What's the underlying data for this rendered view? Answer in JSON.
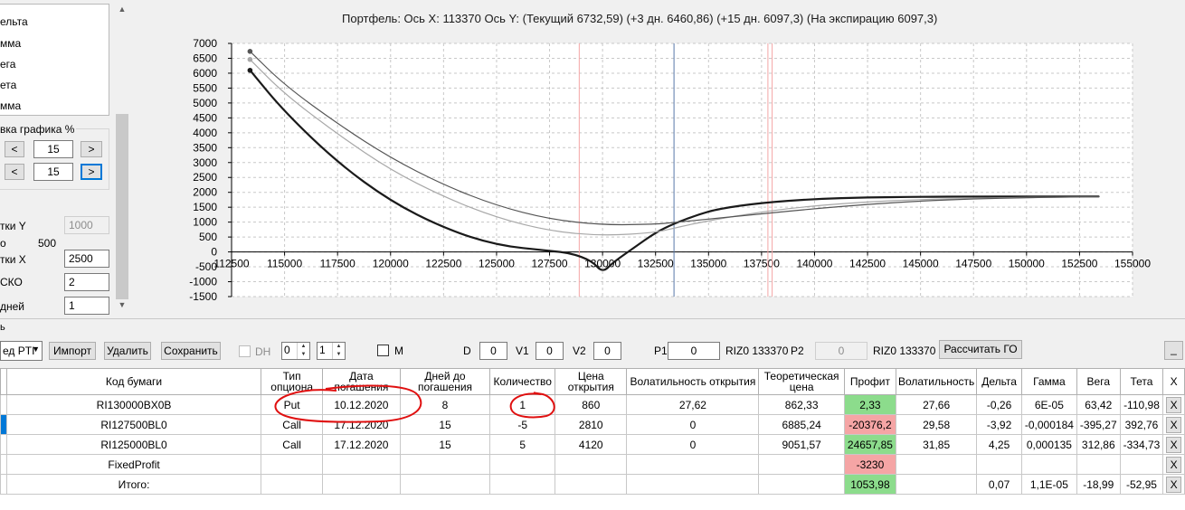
{
  "left_panel": {
    "list_items": [
      "ельта",
      "мма",
      "ега",
      "ета",
      "мма"
    ],
    "group_title": "вка графика %",
    "offset_rows": [
      {
        "prev": "<",
        "value": "15",
        "next": ">"
      },
      {
        "prev": "<",
        "value": "15",
        "next": ">"
      }
    ],
    "fields": [
      {
        "label": "тки Y",
        "value": "1000",
        "disabled": true
      },
      {
        "label": "о",
        "value_text": "500"
      },
      {
        "label": "тки X",
        "value": "2500"
      },
      {
        "label": "СКО",
        "value": "2"
      },
      {
        "label": "дней",
        "value": "1"
      }
    ]
  },
  "chart_title": "Портфель: Ось X: 113370 Ось Y:  (Текущий 6732,59)  (+3 дн. 6460,86)  (+15 дн. 6097,3)  (На экспирацию 6097,3)",
  "chart_data": {
    "type": "line",
    "xlim": [
      112500,
      155000
    ],
    "ylim": [
      -1500,
      7000
    ],
    "x_ticks": [
      "112500",
      "115000",
      "117500",
      "120000",
      "122500",
      "125000",
      "127500",
      "130000",
      "132500",
      "135000",
      "137500",
      "140000",
      "142500",
      "145000",
      "147500",
      "150000",
      "152500",
      "155000"
    ],
    "y_ticks": [
      "7000",
      "6500",
      "6000",
      "5500",
      "5000",
      "4500",
      "4000",
      "3500",
      "3000",
      "2500",
      "2000",
      "1500",
      "1000",
      "500",
      "0",
      "-500",
      "-1000",
      "-1500"
    ],
    "grid": true,
    "vlines": [
      {
        "x": 128900,
        "color": "#f4a6a6"
      },
      {
        "x": 133370,
        "color": "#5878a8"
      },
      {
        "x": 137800,
        "color": "#f4a6a6"
      },
      {
        "x": 138000,
        "color": "#f4a6a6"
      }
    ],
    "series": [
      {
        "color": "#1a1a1a",
        "width": 2.2,
        "x": [
          113370,
          115000,
          117500,
          120000,
          122500,
          125000,
          127500,
          128500,
          129500,
          130000,
          130500,
          131500,
          132500,
          133370,
          134500,
          135500,
          137500,
          140000,
          142500,
          145000,
          147500,
          150000,
          152500,
          153400
        ],
        "y": [
          6097,
          4700,
          3000,
          1700,
          800,
          220,
          40,
          -40,
          -300,
          -700,
          -350,
          150,
          650,
          950,
          1250,
          1450,
          1650,
          1780,
          1830,
          1850,
          1860,
          1860,
          1860,
          1860
        ]
      },
      {
        "color": "#a8a8a8",
        "width": 1.2,
        "x": [
          113370,
          115000,
          117500,
          120000,
          122500,
          125000,
          127500,
          130000,
          132500,
          133370,
          135000,
          137500,
          140000,
          142500,
          145000,
          147500,
          150000,
          152500,
          153400
        ],
        "y": [
          6461,
          5300,
          3950,
          2750,
          1850,
          1150,
          700,
          540,
          650,
          800,
          1050,
          1350,
          1550,
          1680,
          1760,
          1800,
          1830,
          1845,
          1850
        ]
      },
      {
        "color": "#555555",
        "width": 1.2,
        "x": [
          113370,
          115000,
          117500,
          120000,
          122500,
          125000,
          127500,
          130000,
          132500,
          133370,
          135000,
          137500,
          140000,
          142500,
          145000,
          147500,
          150000,
          152500,
          153400
        ],
        "y": [
          6733,
          5600,
          4300,
          3150,
          2250,
          1550,
          1100,
          900,
          930,
          990,
          1100,
          1280,
          1450,
          1600,
          1710,
          1780,
          1820,
          1845,
          1850
        ]
      }
    ]
  },
  "toolbar": {
    "combo_value": "ед PTI",
    "import_label": "Импорт",
    "delete_label": "Удалить",
    "save_label": "Сохранить",
    "dh_label": "DH",
    "spin1_value": "0",
    "spin2_value": "1",
    "m_label": "M",
    "d_label": "D",
    "d_value": "0",
    "v1_label": "V1",
    "v1_value": "0",
    "v2_label": "V2",
    "v2_value": "0",
    "p1_label": "P1",
    "p1_value": "0",
    "riz1_label": "RIZ0 133370",
    "p2_label": "P2",
    "p2_value": "0",
    "riz2_label": "RIZ0 133370",
    "calc_go_label": "Рассчитать ГО",
    "minimize_label": "_"
  },
  "grid": {
    "columns": [
      "Код бумаги",
      "Тип опциона",
      "Дата погашения",
      "Дней до погашения",
      "Количество",
      "Цена открытия",
      "Волатильность открытия",
      "Теоретическая цена",
      "Профит",
      "Волатильность",
      "Дельта",
      "Гамма",
      "Вега",
      "Тета",
      "X"
    ],
    "rows": [
      {
        "code": "RI130000BX0B",
        "type": "Put",
        "date": "10.12.2020",
        "days": "8",
        "qty": "1",
        "open_price": "860",
        "open_vol": "27,62",
        "theo": "862,33",
        "profit": "2,33",
        "profit_color": "green",
        "vol": "27,66",
        "delta": "-0,26",
        "gamma": "6E-05",
        "vega": "63,42",
        "theta": "-110,98",
        "x": "X",
        "selected": false
      },
      {
        "code": "RI127500BL0",
        "type": "Call",
        "date": "17.12.2020",
        "days": "15",
        "qty": "-5",
        "open_price": "2810",
        "open_vol": "0",
        "theo": "6885,24",
        "profit": "-20376,2",
        "profit_color": "red",
        "vol": "29,58",
        "delta": "-3,92",
        "gamma": "-0,000184",
        "vega": "-395,27",
        "theta": "392,76",
        "x": "X",
        "selected": true
      },
      {
        "code": "RI125000BL0",
        "type": "Call",
        "date": "17.12.2020",
        "days": "15",
        "qty": "5",
        "open_price": "4120",
        "open_vol": "0",
        "theo": "9051,57",
        "profit": "24657,85",
        "profit_color": "green",
        "vol": "31,85",
        "delta": "4,25",
        "gamma": "0,000135",
        "vega": "312,86",
        "theta": "-334,73",
        "x": "X",
        "selected": false
      },
      {
        "code": "FixedProfit",
        "type": "",
        "date": "",
        "days": "",
        "qty": "",
        "open_price": "",
        "open_vol": "",
        "theo": "",
        "profit": "-3230",
        "profit_color": "red",
        "vol": "",
        "delta": "",
        "gamma": "",
        "vega": "",
        "theta": "",
        "x": "X",
        "selected": false
      },
      {
        "code": "Итого:",
        "type": "",
        "date": "",
        "days": "",
        "qty": "",
        "open_price": "",
        "open_vol": "",
        "theo": "",
        "profit": "1053,98",
        "profit_color": "green",
        "vol": "",
        "delta": "0,07",
        "gamma": "1,1E-05",
        "vega": "-18,99",
        "theta": "-52,95",
        "x": "X",
        "selected": false
      }
    ]
  },
  "colors": {
    "profit_green": "#8cdc8c",
    "profit_red": "#f5a5a5",
    "selection": "#0078d7",
    "annotation": "#e01010"
  }
}
